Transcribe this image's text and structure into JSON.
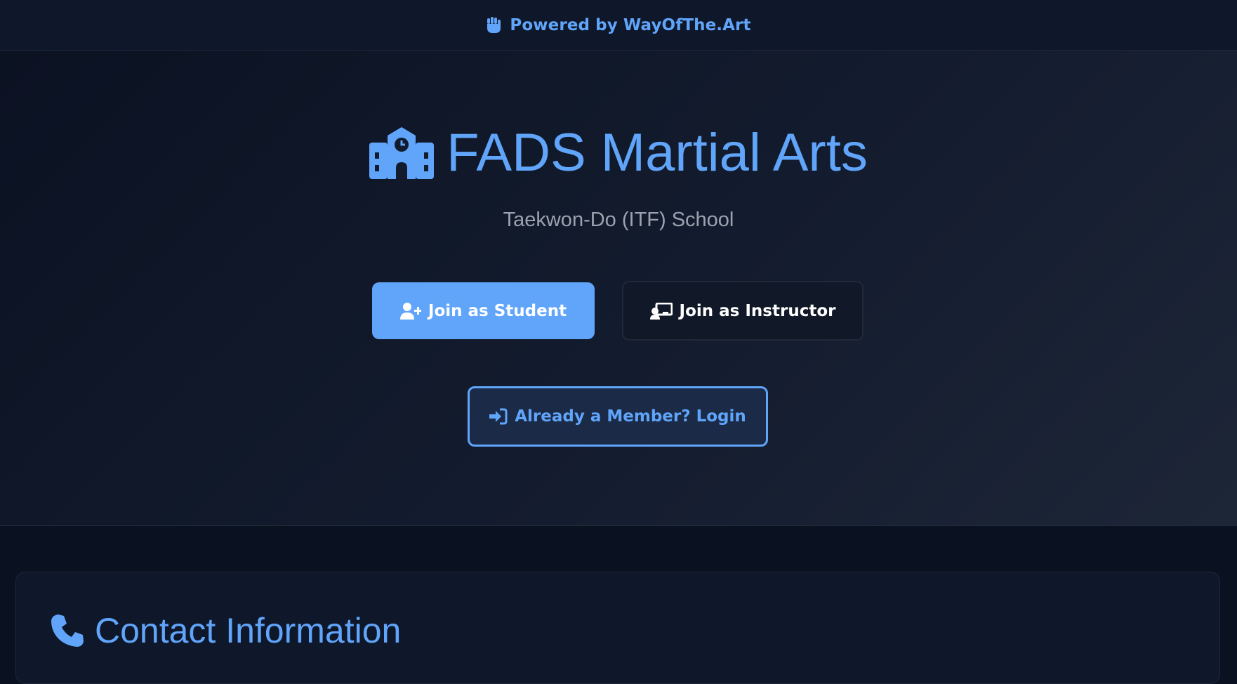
{
  "topbar": {
    "icon": "fist-icon",
    "text": "Powered by WayOfThe.Art"
  },
  "hero": {
    "icon": "school-icon",
    "title": "FADS Martial Arts",
    "subtitle": "Taekwon-Do (ITF) School",
    "buttons": {
      "student": {
        "label": "Join as Student",
        "icon": "user-plus-icon"
      },
      "instructor": {
        "label": "Join as Instructor",
        "icon": "chalkboard-user-icon"
      },
      "login": {
        "label": "Already a Member? Login",
        "icon": "sign-in-icon"
      }
    }
  },
  "contact": {
    "icon": "phone-icon",
    "title": "Contact Information"
  },
  "colors": {
    "accent": "#60a5fa",
    "background": "#0a1120",
    "card": "#0f172a",
    "muted_text": "#9ca3af"
  }
}
